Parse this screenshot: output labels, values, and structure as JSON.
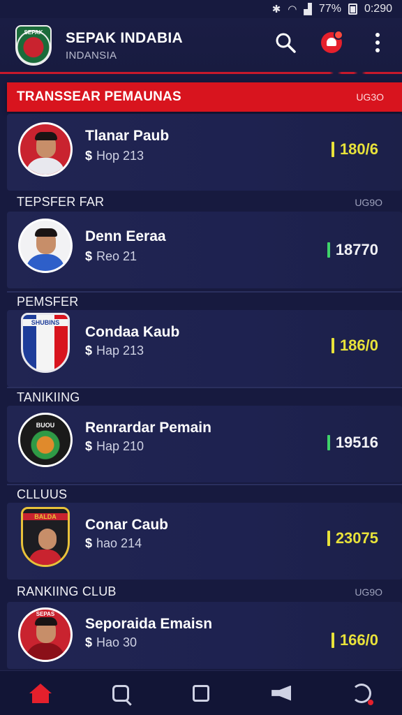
{
  "status_bar": {
    "battery": "77%",
    "time": "0:290"
  },
  "header": {
    "title": "SEPAK INDABIA",
    "subtitle": "INDANSIA",
    "logo_text": "SEPAK"
  },
  "banner": {
    "title": "TRANSSEAR PEMAUNAS",
    "meta": "UG3O"
  },
  "sections": [
    {
      "label": "TEPSFER FAR",
      "meta": "UG9O"
    },
    {
      "label": "PEMSFER",
      "meta": ""
    },
    {
      "label": "TANIKIING",
      "meta": ""
    },
    {
      "label": "CLLUUS",
      "meta": ""
    },
    {
      "label": "RANKIING CLUB",
      "meta": "UG9O"
    }
  ],
  "items": [
    {
      "name": "Tlanar Paub",
      "dollar": "$",
      "value": "Hop 213",
      "rating": "180/6",
      "rating_color": "#e8e23a"
    },
    {
      "name": "Denn Eeraa",
      "dollar": "$",
      "value": "Reo 21",
      "rating": "18770",
      "rating_color": "#3fd36a"
    },
    {
      "name": "Condaa Kaub",
      "dollar": "$",
      "value": "Hap 213",
      "rating": "186/0",
      "rating_color": "#e8e23a"
    },
    {
      "name": "Renrardar Pemain",
      "dollar": "$",
      "value": "Hap 210",
      "rating": "19516",
      "rating_color": "#3fd36a"
    },
    {
      "name": "Conar Caub",
      "dollar": "$",
      "value": "hao 214",
      "rating": "23075",
      "rating_color": "#e8e23a"
    },
    {
      "name": "Seporaida Emaisn",
      "dollar": "$",
      "value": "Hao 30",
      "rating": "166/0",
      "rating_color": "#e8e23a"
    }
  ],
  "crest_text": [
    "SHUBINS",
    "BUOU",
    "BALDA",
    "SEPAS"
  ],
  "nav": [
    "home-icon",
    "search-icon",
    "square-icon",
    "megaphone-icon",
    "gauge-icon"
  ]
}
